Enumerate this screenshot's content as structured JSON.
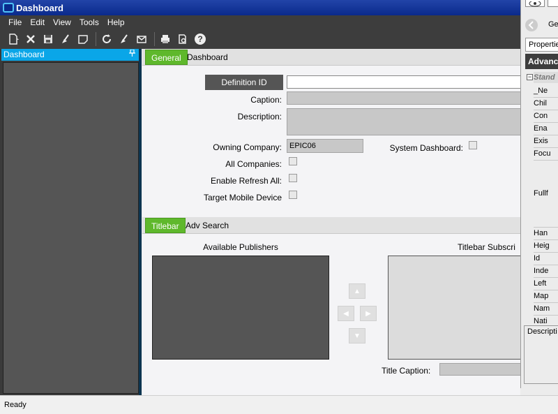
{
  "window": {
    "title": "Dashboard"
  },
  "menu": {
    "items": [
      "File",
      "Edit",
      "View",
      "Tools",
      "Help"
    ]
  },
  "toolbar": {
    "icons": [
      "new-icon",
      "close-x-icon",
      "save-icon",
      "clear-icon",
      "note-icon",
      "refresh-icon",
      "clear-all-icon",
      "email-icon",
      "print-icon",
      "print-preview-icon",
      "help-icon"
    ]
  },
  "left_pane": {
    "title": "Dashboard"
  },
  "tabs": {
    "general": "General",
    "dashboard": "Dashboard"
  },
  "form": {
    "definition_id_label": "Definition ID",
    "definition_id_value": "",
    "caption_label": "Caption:",
    "description_label": "Description:",
    "owning_company_label": "Owning Company:",
    "owning_company_value": "EPIC06",
    "system_dashboard_label": "System Dashboard:",
    "all_companies_label": "All Companies:",
    "enable_refresh_all_label": "Enable Refresh All:",
    "target_mobile_device_label": "Target Mobile Device"
  },
  "subtabs": {
    "titlebar": "Titlebar",
    "adv_search": "Adv Search"
  },
  "titlebar_section": {
    "available_publishers": "Available Publishers",
    "titlebar_subscribers": "Titlebar Subscri",
    "title_caption_label": "Title Caption:"
  },
  "right_pane": {
    "tab_general": "Gen",
    "tab_properties": "Propertie",
    "header": "Advance",
    "group": "Stand",
    "rows": [
      "_Ne",
      "Chil",
      "Con",
      "Ena",
      "Exis",
      "Focu",
      "Fullf",
      "Han",
      "Heig",
      "Id",
      "Inde",
      "Left",
      "Map",
      "Nam",
      "Nati"
    ],
    "description_label": "Descripti"
  },
  "status": {
    "text": "Ready"
  },
  "colors": {
    "accent_tab": "#5fb82c",
    "title_bar": "#0a2a8c",
    "pane_header": "#0aa6e8"
  }
}
